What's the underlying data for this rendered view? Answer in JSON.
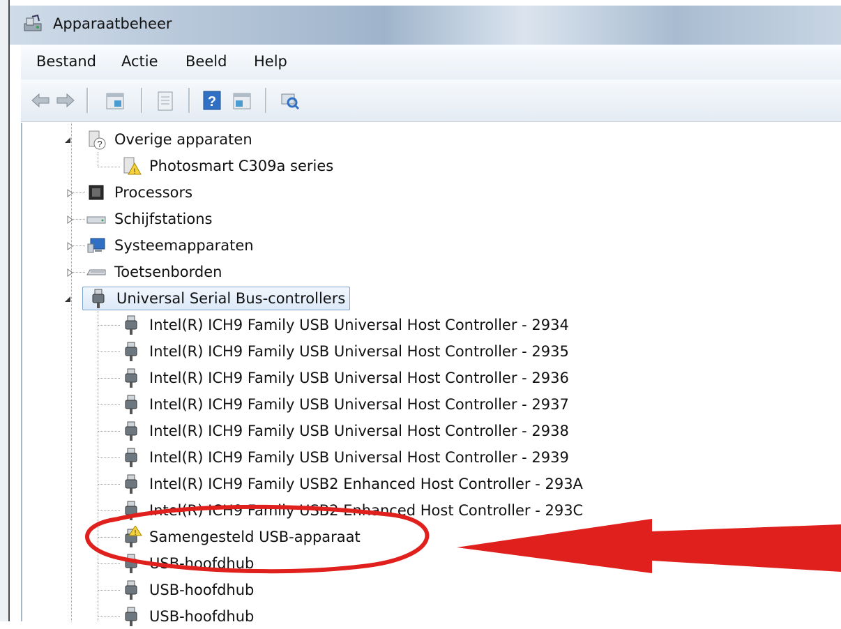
{
  "window": {
    "title": "Apparaatbeheer"
  },
  "menu": [
    "Bestand",
    "Actie",
    "Beeld",
    "Help"
  ],
  "toolbar": {
    "buttons": [
      "back-icon",
      "forward-icon",
      "show-hide-console-tree-icon",
      "properties-icon",
      "help-icon",
      "action-pane-icon",
      "scan-hardware-changes-icon"
    ]
  },
  "tree": {
    "other_devices": {
      "label": "Overige apparaten",
      "children": [
        "Photosmart C309a series"
      ]
    },
    "processors": "Processors",
    "disk_drives": "Schijfstations",
    "system_devices": "Systeemapparaten",
    "keyboards": "Toetsenborden",
    "usb": {
      "label": "Universal Serial Bus-controllers",
      "children": [
        "Intel(R) ICH9 Family USB Universal Host Controller - 2934",
        "Intel(R) ICH9 Family USB Universal Host Controller - 2935",
        "Intel(R) ICH9 Family USB Universal Host Controller - 2936",
        "Intel(R) ICH9 Family USB Universal Host Controller - 2937",
        "Intel(R) ICH9 Family USB Universal Host Controller - 2938",
        "Intel(R) ICH9 Family USB Universal Host Controller - 2939",
        "Intel(R) ICH9 Family USB2 Enhanced Host Controller - 293A",
        "Intel(R) ICH9 Family USB2 Enhanced Host Controller - 293C",
        "Samengesteld USB-apparaat",
        "USB-hoofdhub",
        "USB-hoofdhub",
        "USB-hoofdhub"
      ]
    }
  },
  "colors": {
    "annotation": "#e0201c",
    "selection_border": "#7da2ce"
  }
}
